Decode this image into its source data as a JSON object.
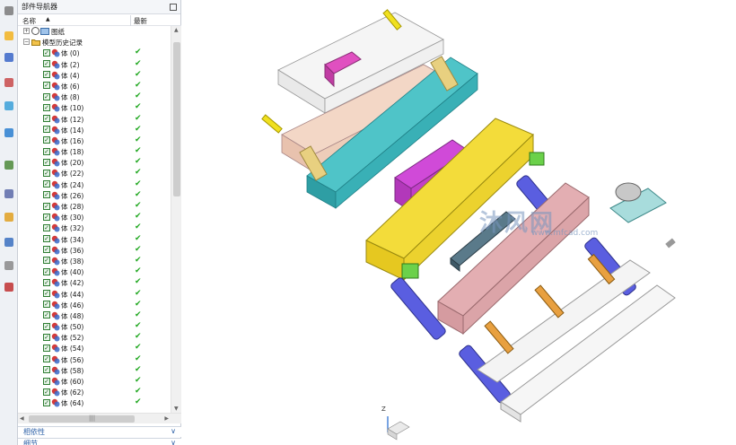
{
  "navigator": {
    "title": "部件导航器",
    "col_name": "名称",
    "col_new": "最新",
    "tree": {
      "drawing_label": "图纸",
      "history_label": "模型历史记录",
      "bodies": [
        "体 (0)",
        "体 (2)",
        "体 (4)",
        "体 (6)",
        "体 (8)",
        "体 (10)",
        "体 (12)",
        "体 (14)",
        "体 (16)",
        "体 (18)",
        "体 (20)",
        "体 (22)",
        "体 (24)",
        "体 (26)",
        "体 (28)",
        "体 (30)",
        "体 (32)",
        "体 (34)",
        "体 (36)",
        "体 (38)",
        "体 (40)",
        "体 (42)",
        "体 (44)",
        "体 (46)",
        "体 (48)",
        "体 (50)",
        "体 (52)",
        "体 (54)",
        "体 (56)",
        "体 (58)",
        "体 (60)",
        "体 (62)",
        "体 (64)"
      ]
    },
    "sections": {
      "dependency": "相依性",
      "details": "细节"
    }
  },
  "toolbar_icons": [
    "gear-icon",
    "assembly-navigator-icon",
    "constraint-navigator-icon",
    "part-navigator-icon",
    "roles-icon",
    "web-browser-icon",
    "document-icon",
    "history-icon",
    "visualization-icon",
    "reuse-library-icon",
    "system-materials-icon",
    "process-studio-icon"
  ],
  "viewport": {
    "watermark": "沐风网",
    "watermark_url": "www.mfcad.com",
    "triad_axis_z": "Z"
  },
  "colors": {
    "panel_bg": "#eef1f5",
    "check_green": "#22a822",
    "section_blue": "#2f62a8"
  }
}
